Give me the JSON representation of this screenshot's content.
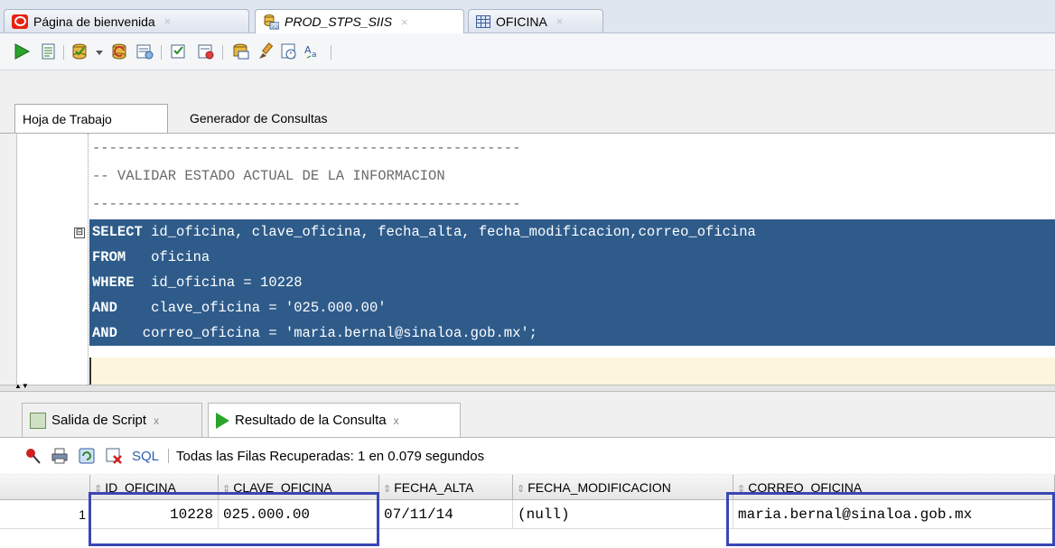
{
  "doc_tabs": [
    {
      "label": "Página de bienvenida",
      "icon": "oracle-logo-icon"
    },
    {
      "label": "PROD_STPS_SIIS",
      "icon": "sql-connection-icon"
    },
    {
      "label": "OFICINA",
      "icon": "table-icon"
    }
  ],
  "tab_close_glyph": "×",
  "worksheet_tabs": [
    "Hoja de Trabajo",
    "Generador de Consultas"
  ],
  "toolbar_icons": [
    "run-statement-icon",
    "run-script-icon",
    "commit-icon",
    "dropdown-arrow-icon",
    "rollback-icon",
    "autotrace-icon",
    "explain-plan-icon",
    "sql-tuning-icon",
    "sql-history-icon",
    "clear-icon",
    "unshared-worksheet-icon",
    "format-icon"
  ],
  "editor": {
    "lines": [
      {
        "text": "---------------------------------------------------",
        "kind": "comment"
      },
      {
        "text": "-- VALIDAR ESTADO ACTUAL DE LA INFORMACION",
        "kind": "comment"
      },
      {
        "text": "---------------------------------------------------",
        "kind": "comment"
      },
      {
        "keyword": "SELECT",
        "rest": " id_oficina, clave_oficina, fecha_alta, fecha_modificacion,correo_oficina",
        "kind": "selected"
      },
      {
        "keyword": "FROM",
        "rest": "   oficina",
        "kind": "selected"
      },
      {
        "keyword": "WHERE",
        "rest": "  id_oficina = 10228",
        "kind": "selected"
      },
      {
        "keyword": "AND",
        "rest": "    clave_oficina = '025.000.00'",
        "kind": "selected"
      },
      {
        "keyword": "AND",
        "rest": "   correo_oficina = 'maria.bernal@sinaloa.gob.mx';",
        "kind": "selected"
      },
      {
        "text": "",
        "kind": "current"
      }
    ],
    "fold_glyph": "⊟"
  },
  "output_tabs": [
    {
      "label": "Salida de Script",
      "icon": "script-output-icon"
    },
    {
      "label": "Resultado de la Consulta",
      "icon": "query-result-icon"
    }
  ],
  "output_close_glyph": "x",
  "results_toolbar": {
    "sql_label": "SQL",
    "status": "Todas las Filas Recuperadas: 1 en 0.079 segundos"
  },
  "grid": {
    "columns": [
      "ID_OFICINA",
      "CLAVE_OFICINA",
      "FECHA_ALTA",
      "FECHA_MODIFICACION",
      "CORREO_OFICINA"
    ],
    "rows": [
      {
        "num": "1",
        "cells": [
          "10228",
          "025.000.00",
          "07/11/14",
          "(null)",
          "maria.bernal@sinaloa.gob.mx"
        ]
      }
    ],
    "highlight_color": "#3b46b5"
  },
  "colors": {
    "selection": "#2e5b8a",
    "current_line": "#fdf6dc",
    "sql_link": "#2b5fb0",
    "run_green": "#2aa42a"
  }
}
